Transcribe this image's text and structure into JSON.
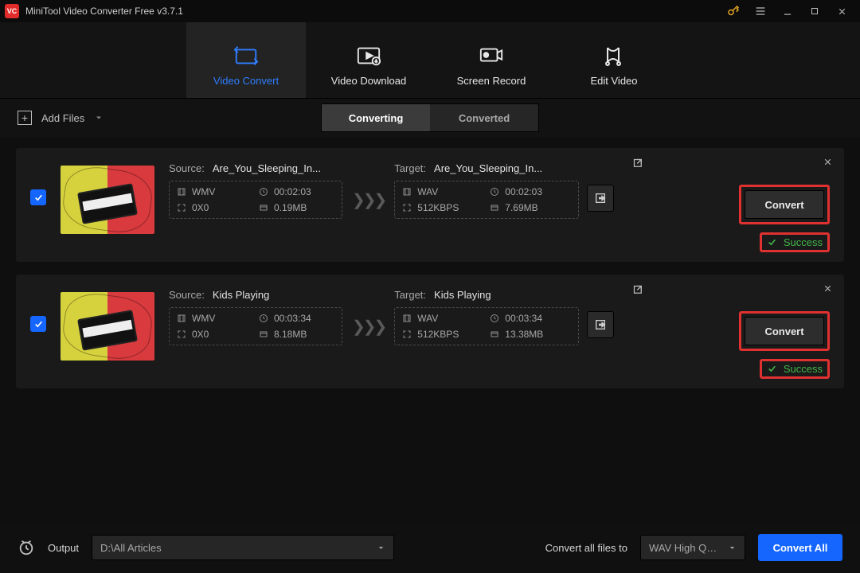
{
  "titlebar": {
    "title": "MiniTool Video Converter Free v3.7.1"
  },
  "mainnav": {
    "items": [
      {
        "label": "Video Convert",
        "active": true
      },
      {
        "label": "Video Download",
        "active": false
      },
      {
        "label": "Screen Record",
        "active": false
      },
      {
        "label": "Edit Video",
        "active": false
      }
    ]
  },
  "toolbar": {
    "add_files": "Add Files",
    "seg_converting": "Converting",
    "seg_converted": "Converted"
  },
  "items": [
    {
      "checked": true,
      "source": {
        "label": "Source:",
        "filename": "Are_You_Sleeping_In...",
        "format": "WMV",
        "duration": "00:02:03",
        "resolution": "0X0",
        "size": "0.19MB"
      },
      "target": {
        "label": "Target:",
        "filename": "Are_You_Sleeping_In...",
        "format": "WAV",
        "duration": "00:02:03",
        "bitrate": "512KBPS",
        "size": "7.69MB"
      },
      "convert_label": "Convert",
      "status": "Success"
    },
    {
      "checked": true,
      "source": {
        "label": "Source:",
        "filename": "Kids Playing",
        "format": "WMV",
        "duration": "00:03:34",
        "resolution": "0X0",
        "size": "8.18MB"
      },
      "target": {
        "label": "Target:",
        "filename": "Kids Playing",
        "format": "WAV",
        "duration": "00:03:34",
        "bitrate": "512KBPS",
        "size": "13.38MB"
      },
      "convert_label": "Convert",
      "status": "Success"
    }
  ],
  "footer": {
    "output_label": "Output",
    "output_path": "D:\\All Articles",
    "convert_all_to": "Convert all files to",
    "preset": "WAV High Qualit...",
    "convert_all": "Convert All"
  }
}
